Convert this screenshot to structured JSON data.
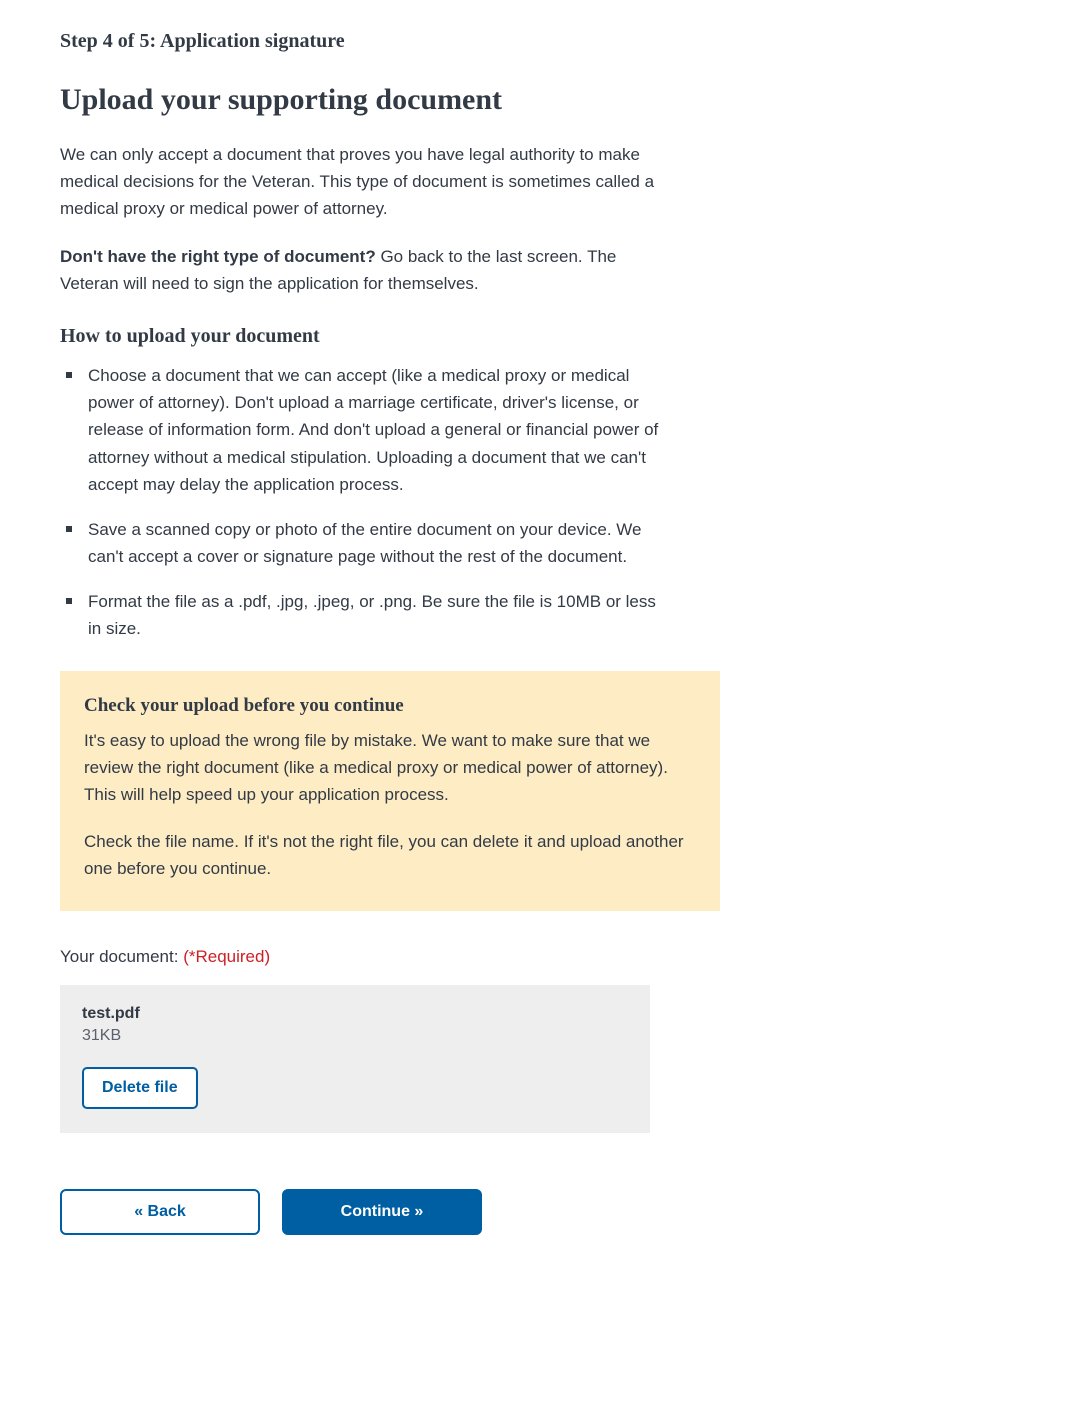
{
  "step_label": "Step 4 of 5: Application signature",
  "heading": "Upload your supporting document",
  "intro_paragraph": "We can only accept a document that proves you have legal authority to make medical decisions for the Veteran. This type of document is sometimes called a medical proxy or medical power of attorney.",
  "noright_bold": "Don't have the right type of document?",
  "noright_rest": " Go back to the last screen. The Veteran will need to sign the application for themselves.",
  "howto_heading": "How to upload your document",
  "howto_items": [
    "Choose a document that we can accept (like a medical proxy or medical power of attorney). Don't upload a marriage certificate, driver's license, or release of information form. And don't upload a general or financial power of attorney without a medical stipulation. Uploading a document that we can't accept may delay the application process.",
    "Save a scanned copy or photo of the entire document on your device. We can't accept a cover or signature page without the rest of the document.",
    "Format the file as a .pdf, .jpg, .jpeg, or .png. Be sure the file is 10MB or less in size."
  ],
  "alert": {
    "heading": "Check your upload before you continue",
    "p1": "It's easy to upload the wrong file by mistake. We want to make sure that we review the right document (like a medical proxy or medical power of attorney). This will help speed up your application process.",
    "p2": "Check the file name. If it's not the right file, you can delete it and upload another one before you continue."
  },
  "field": {
    "label": "Your document: ",
    "required": "(*Required)"
  },
  "file": {
    "name": "test.pdf",
    "size": "31KB",
    "delete_label": "Delete file"
  },
  "nav": {
    "back": "« Back",
    "continue": "Continue »"
  }
}
